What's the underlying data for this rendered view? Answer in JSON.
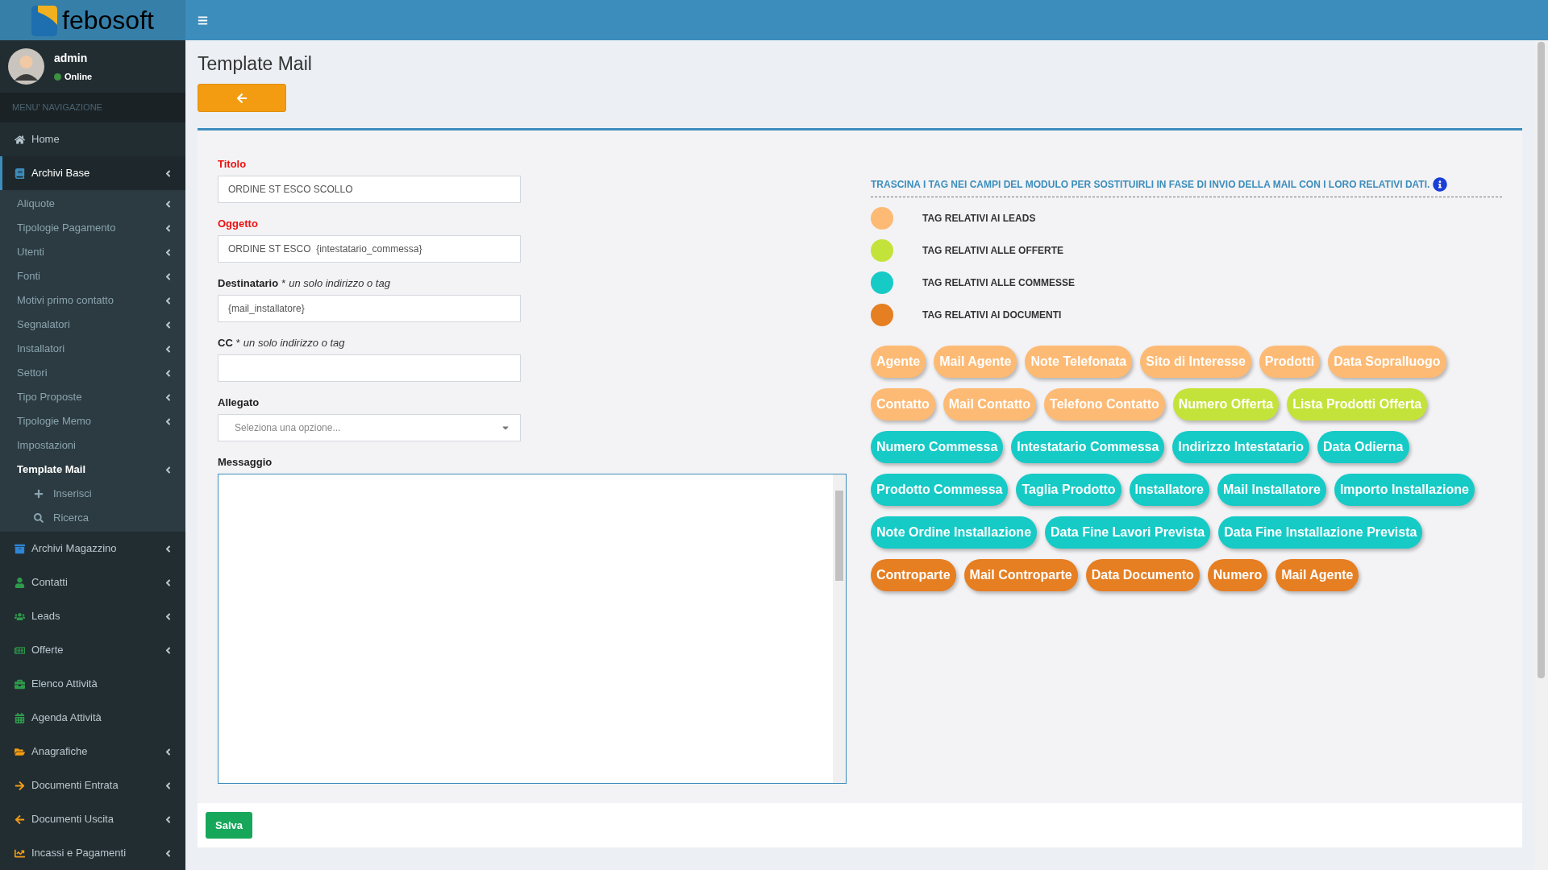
{
  "header": {
    "logo_text": "febosoft"
  },
  "user": {
    "name": "admin",
    "status": "Online"
  },
  "sidebar": {
    "section_title": "MENU' NAVIGAZIONE",
    "items": [
      {
        "label": "Home",
        "selected": false,
        "arrow": false
      },
      {
        "label": "Archivi Base",
        "selected": true,
        "arrow": true,
        "children": [
          {
            "label": "Aliquote",
            "selected": false,
            "arrow": true
          },
          {
            "label": "Tipologie Pagamento",
            "selected": false,
            "arrow": true
          },
          {
            "label": "Utenti",
            "selected": false,
            "arrow": true
          },
          {
            "label": "Fonti",
            "selected": false,
            "arrow": true
          },
          {
            "label": "Motivi primo contatto",
            "selected": false,
            "arrow": true
          },
          {
            "label": "Segnalatori",
            "selected": false,
            "arrow": true
          },
          {
            "label": "Installatori",
            "selected": false,
            "arrow": true
          },
          {
            "label": "Settori",
            "selected": false,
            "arrow": true
          },
          {
            "label": "Tipo Proposte",
            "selected": false,
            "arrow": true
          },
          {
            "label": "Tipologie Memo",
            "selected": false,
            "arrow": true
          },
          {
            "label": "Impostazioni",
            "selected": false,
            "arrow": false
          },
          {
            "label": "Template Mail",
            "selected": true,
            "arrow": true,
            "children": [
              {
                "label": "Inserisci",
                "selected": false
              },
              {
                "label": "Ricerca",
                "selected": false
              }
            ]
          }
        ]
      },
      {
        "label": "Archivi Magazzino",
        "selected": false,
        "arrow": true
      },
      {
        "label": "Contatti",
        "selected": false,
        "arrow": true
      },
      {
        "label": "Leads",
        "selected": false,
        "arrow": true
      },
      {
        "label": "Offerte",
        "selected": false,
        "arrow": true
      },
      {
        "label": "Elenco Attività",
        "selected": false,
        "arrow": false
      },
      {
        "label": "Agenda Attività",
        "selected": false,
        "arrow": false
      },
      {
        "label": "Anagrafiche",
        "selected": false,
        "arrow": true
      },
      {
        "label": "Documenti Entrata",
        "selected": false,
        "arrow": true
      },
      {
        "label": "Documenti Uscita",
        "selected": false,
        "arrow": true
      },
      {
        "label": "Incassi e Pagamenti",
        "selected": false,
        "arrow": true
      }
    ]
  },
  "page": {
    "title": "Template Mail"
  },
  "form": {
    "fields": [
      {
        "kind": "text",
        "label": "Titolo",
        "required": true,
        "value": "ORDINE ST ESCO SCOLLO"
      },
      {
        "kind": "text",
        "label": "Oggetto",
        "required": true,
        "value": "ORDINE ST ESCO  {intestatario_commessa}"
      },
      {
        "kind": "text",
        "label": "Destinatario",
        "required": false,
        "note": "un solo indirizzo o tag",
        "mark": "*",
        "value": "{mail_installatore}"
      },
      {
        "kind": "text",
        "label": "CC",
        "required": false,
        "note": "un solo indirizzo o tag",
        "mark": "*"
      },
      {
        "kind": "select",
        "label": "Allegato",
        "required": false,
        "placeholder": "Seleziona una opzione..."
      },
      {
        "kind": "textarea",
        "label": "Messaggio",
        "required": false
      }
    ],
    "save_button": "Salva"
  },
  "tags_panel": {
    "instructions": "TRASCINA I TAG NEI CAMPI DEL MODULO PER SOSTITUIRLI IN FASE DI INVIO DELLA MAIL CON I LORO RELATIVI DATI.",
    "legend": [
      {
        "label": "TAG RELATIVI AI LEADS",
        "color": "#fdba74"
      },
      {
        "label": "TAG RELATIVI ALLE OFFERTE",
        "color": "#c4e33a"
      },
      {
        "label": "TAG RELATIVI ALLE COMMESSE",
        "color": "#16cac6"
      },
      {
        "label": "TAG RELATIVI AI DOCUMENTI",
        "color": "#e67e22"
      }
    ],
    "tags": [
      {
        "label": "Agente",
        "color": "#fdba74"
      },
      {
        "label": "Mail Agente",
        "color": "#fdba74"
      },
      {
        "label": "Note Telefonata",
        "color": "#fdba74"
      },
      {
        "label": "Sito di Interesse",
        "color": "#fdba74"
      },
      {
        "label": "Prodotti",
        "color": "#fdba74"
      },
      {
        "label": "Data Sopralluogo",
        "color": "#fdba74"
      },
      {
        "label": "Contatto",
        "color": "#fdba74"
      },
      {
        "label": "Mail Contatto",
        "color": "#fdba74"
      },
      {
        "label": "Telefono Contatto",
        "color": "#fdba74"
      },
      {
        "label": "Numero Offerta",
        "color": "#c4e33a"
      },
      {
        "label": "Lista Prodotti Offerta",
        "color": "#c4e33a"
      },
      {
        "label": "Numero Commessa",
        "color": "#16cac6"
      },
      {
        "label": "Intestatario Commessa",
        "color": "#16cac6"
      },
      {
        "label": "Indirizzo Intestatario",
        "color": "#16cac6"
      },
      {
        "label": "Data Odierna",
        "color": "#16cac6"
      },
      {
        "label": "Prodotto Commessa",
        "color": "#16cac6"
      },
      {
        "label": "Taglia Prodotto",
        "color": "#16cac6"
      },
      {
        "label": "Installatore",
        "color": "#16cac6"
      },
      {
        "label": "Mail Installatore",
        "color": "#16cac6"
      },
      {
        "label": "Importo Installazione",
        "color": "#16cac6"
      },
      {
        "label": "Note Ordine Installazione",
        "color": "#16cac6"
      },
      {
        "label": "Data Fine Lavori Prevista",
        "color": "#16cac6"
      },
      {
        "label": "Data Fine Installazione Prevista",
        "color": "#16cac6"
      },
      {
        "label": "Controparte",
        "color": "#e67e22"
      },
      {
        "label": "Mail Controparte",
        "color": "#e67e22"
      },
      {
        "label": "Data Documento",
        "color": "#e67e22"
      },
      {
        "label": "Numero",
        "color": "#e67e22"
      },
      {
        "label": "Mail Agente",
        "color": "#e67e22"
      }
    ]
  }
}
